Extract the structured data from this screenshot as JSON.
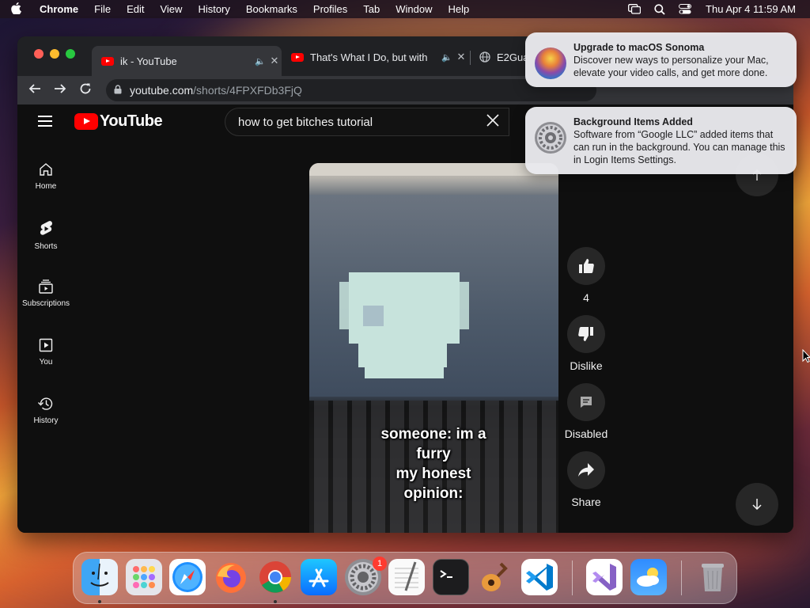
{
  "menubar": {
    "apple_icon": "apple-logo-icon",
    "app_name": "Chrome",
    "items": [
      "File",
      "Edit",
      "View",
      "History",
      "Bookmarks",
      "Profiles",
      "Tab",
      "Window",
      "Help"
    ],
    "status_icons": [
      "screen-mirroring-icon",
      "spotlight-search-icon",
      "control-center-icon"
    ],
    "clock": "Thu Apr 4  11:59 AM"
  },
  "browser": {
    "tabs": [
      {
        "title": "ik - YouTube",
        "favicon": "youtube-icon",
        "audio": true,
        "active": true
      },
      {
        "title": "That's What I Do, but with",
        "favicon": "youtube-icon",
        "audio": true,
        "active": false
      },
      {
        "title": "E2Gua",
        "favicon": "globe-icon",
        "audio": false,
        "active": false
      }
    ],
    "url_host": "youtube.com",
    "url_path": "/shorts/4FPXFDb3FjQ"
  },
  "youtube": {
    "logo_text": "YouTube",
    "search_query": "how to get bitches tutorial",
    "guide": [
      {
        "label": "Home",
        "icon": "home-icon"
      },
      {
        "label": "Shorts",
        "icon": "shorts-icon"
      },
      {
        "label": "Subscriptions",
        "icon": "subscriptions-icon"
      },
      {
        "label": "You",
        "icon": "you-library-icon"
      },
      {
        "label": "History",
        "icon": "history-icon"
      }
    ],
    "short": {
      "caption_lines": [
        "someone: im a",
        "furry",
        "my honest",
        "opinion:"
      ]
    },
    "actions": {
      "like_count": "4",
      "dislike_label": "Dislike",
      "comments_label": "Disabled",
      "share_label": "Share"
    }
  },
  "notifications": [
    {
      "title": "Upgrade to macOS Sonoma",
      "body": "Discover new ways to personalize your Mac, elevate your video calls, and get more done.",
      "icon": "macos-sonoma-icon"
    },
    {
      "title": "Background Items Added",
      "body": "Software from “Google LLC” added items that can run in the background. You can manage this in Login Items Settings.",
      "icon": "system-settings-icon"
    }
  ],
  "dock": {
    "apps": [
      "finder-icon",
      "launchpad-icon",
      "safari-icon",
      "firefox-icon",
      "chrome-icon",
      "app-store-icon",
      "system-settings-icon",
      "textedit-icon",
      "terminal-icon",
      "garageband-icon",
      "vscode-icon",
      "visual-studio-icon",
      "weather-icon",
      "trash-icon"
    ],
    "settings_badge": "1"
  },
  "colors": {
    "youtube_red": "#ff0000",
    "page_bg": "#0f0f0f",
    "chrome_tabstrip": "#202124",
    "chrome_toolbar": "#35363a"
  }
}
